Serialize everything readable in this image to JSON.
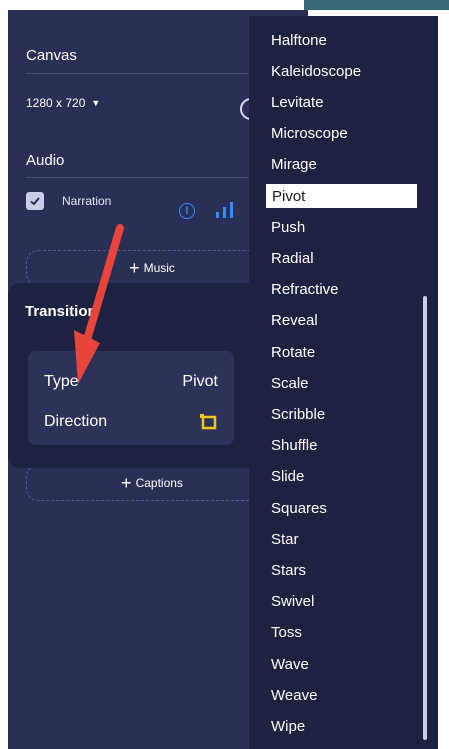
{
  "canvas": {
    "title": "Canvas",
    "size_label": "1280 x 720"
  },
  "audio": {
    "title": "Audio",
    "narration_label": "Narration",
    "music_button": "Music",
    "captions_button": "Captions"
  },
  "transition": {
    "title": "Transition",
    "type_label": "Type",
    "type_value": "Pivot",
    "direction_label": "Direction"
  },
  "dropdown": {
    "selected": "Pivot",
    "items": [
      "Halftone",
      "Kaleidoscope",
      "Levitate",
      "Microscope",
      "Mirage",
      "Pivot",
      "Push",
      "Radial",
      "Refractive",
      "Reveal",
      "Rotate",
      "Scale",
      "Scribble",
      "Shuffle",
      "Slide",
      "Squares",
      "Star",
      "Stars",
      "Swivel",
      "Toss",
      "Wave",
      "Weave",
      "Wipe"
    ]
  },
  "colors": {
    "panel_bg": "#2a2f55",
    "dropdown_bg": "#1d2240",
    "arrow_red": "#e8443a",
    "accent_blue": "#2f8cff",
    "direction_icon": "#f2c81b"
  },
  "icons": {
    "caret": "caret-down-icon",
    "check": "check-icon",
    "info": "info-icon",
    "signal": "signal-bars-icon",
    "plus": "plus-icon",
    "direction": "direction-frame-icon"
  }
}
